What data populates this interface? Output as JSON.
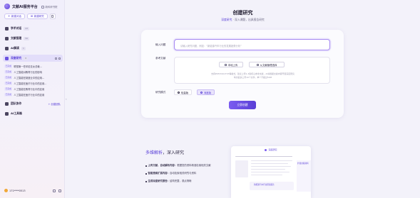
{
  "sidebar": {
    "brand": "文献AI服务平台",
    "brand_link": "新科研书院",
    "new_chat": "新建对话",
    "new_research": "新建研究",
    "nav": {
      "academic": {
        "label": "学术对话",
        "count": "43"
      },
      "literature": {
        "label": "文献管理",
        "count": "56"
      },
      "kb": {
        "label": "AI解读",
        "count": "1"
      },
      "research": {
        "label": "深度研究",
        "count": "8"
      }
    },
    "sub_items": [
      {
        "tag": "已完成",
        "title": "联想第一任印尼亚太总裁..."
      },
      {
        "tag": "已完成",
        "title": "人工智能对教育行业的影响"
      },
      {
        "tag": "已完成",
        "title": "人工智能在制造业中的应用..."
      },
      {
        "tag": "已完成",
        "title": "人工智能在医疗行业中的应用..."
      },
      {
        "tag": "已完成",
        "title": "人工智能在教育行业中的应用"
      },
      {
        "tag": "已完成",
        "title": "人工智能在医疗行业中的应用"
      }
    ],
    "team": {
      "label": "团队协作",
      "action": "+ 创建团队"
    },
    "tools": {
      "label": "AI工具箱"
    },
    "user": "171****0513"
  },
  "main": {
    "title": "创建研究",
    "subtitle_prefix": "深度研究",
    "subtitle_rest": "深入课题，出具报告研究",
    "form": {
      "topic_label": "输入问题",
      "topic_placeholder": "请输入研究问题，例如：“新能源汽车行业的发展趋势分析”",
      "ref_label": "参考文献",
      "local_upload": "本地上传",
      "from_library": "从文献管理选择",
      "hint_line1": "支持PDF/DOC/TXT等格式，建议上传1-3篇核心参考文献，AI将根据文献内容开展深度研究",
      "hint_line2": "每次最多上传10个文件，单个不超过50M",
      "mode_label": "研究模式",
      "mode_quick": "轻量版",
      "mode_deep": "深度版",
      "submit": "立即创建"
    },
    "feature": {
      "title_a": "多维解析",
      "title_b": "深入研究",
      "items": [
        {
          "bold": "上传文献，自动解析内容：",
          "text": "根据您的资料精准检索相关文献"
        },
        {
          "bold": "智能搜索扩展内容：",
          "text": "自动检索相关研究与资料"
        },
        {
          "bold": "生成深度研究报告：",
          "text": "结构完整，观点清晰"
        }
      ]
    },
    "preview": {
      "header": "深度研究",
      "side_tag": "扩展文献资料",
      "card": "新能源汽车行业研究报告"
    }
  }
}
